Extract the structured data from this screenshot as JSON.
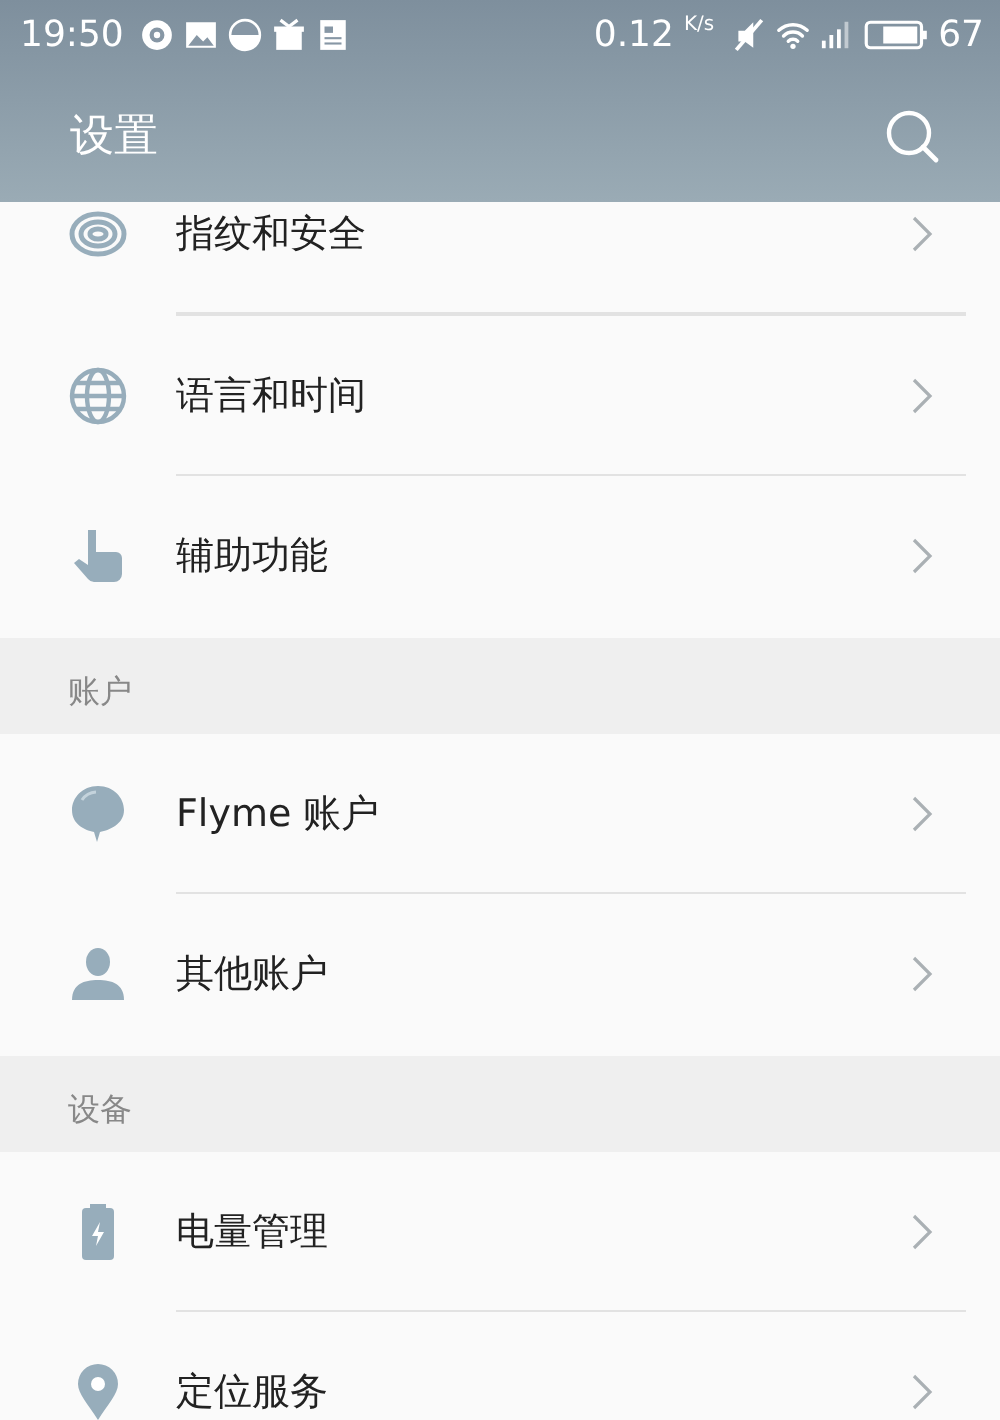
{
  "status_bar": {
    "time": "19:50",
    "speed": "0.12",
    "speed_unit": "K/s",
    "battery": "67"
  },
  "app_bar": {
    "title": "设置"
  },
  "sections": [
    {
      "items": [
        {
          "label": "指纹和安全"
        },
        {
          "label": "语言和时间"
        },
        {
          "label": "辅助功能"
        }
      ]
    },
    {
      "title": "账户",
      "items": [
        {
          "label": "Flyme 账户"
        },
        {
          "label": "其他账户"
        }
      ]
    },
    {
      "title": "设备",
      "items": [
        {
          "label": "电量管理"
        },
        {
          "label": "定位服务"
        }
      ]
    }
  ]
}
